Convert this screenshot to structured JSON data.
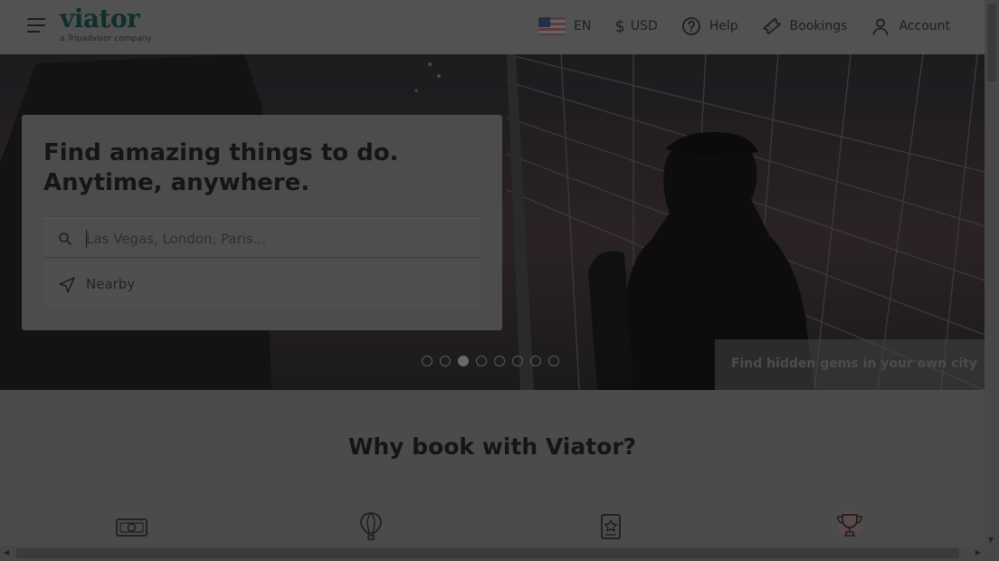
{
  "header": {
    "logo_text": "viator",
    "logo_tagline": "a Tripadvisor company",
    "language": "EN",
    "currency_symbol": "$",
    "currency": "USD",
    "help_label": "Help",
    "bookings_label": "Bookings",
    "account_label": "Account",
    "icons": [
      "menu-icon",
      "us-flag-icon",
      "dollar-icon",
      "help-icon",
      "ticket-icon",
      "user-icon"
    ]
  },
  "hero": {
    "title_line1": "Find amazing things to do.",
    "title_line2": "Anytime, anywhere.",
    "search_placeholder": "Las Vegas, London, Paris...",
    "nearby_label": "Nearby",
    "carousel_dots": 8,
    "carousel_active_index": 2,
    "caption": "Find hidden gems in your own city"
  },
  "why": {
    "title": "Why book with Viator?",
    "feature_icons": [
      "cash-icon",
      "hot-air-balloon-icon",
      "review-star-icon",
      "trophy-icon"
    ]
  },
  "colors": {
    "overlay_tint": "#4b4b4b",
    "brand_dark": "#0e2f2a"
  }
}
